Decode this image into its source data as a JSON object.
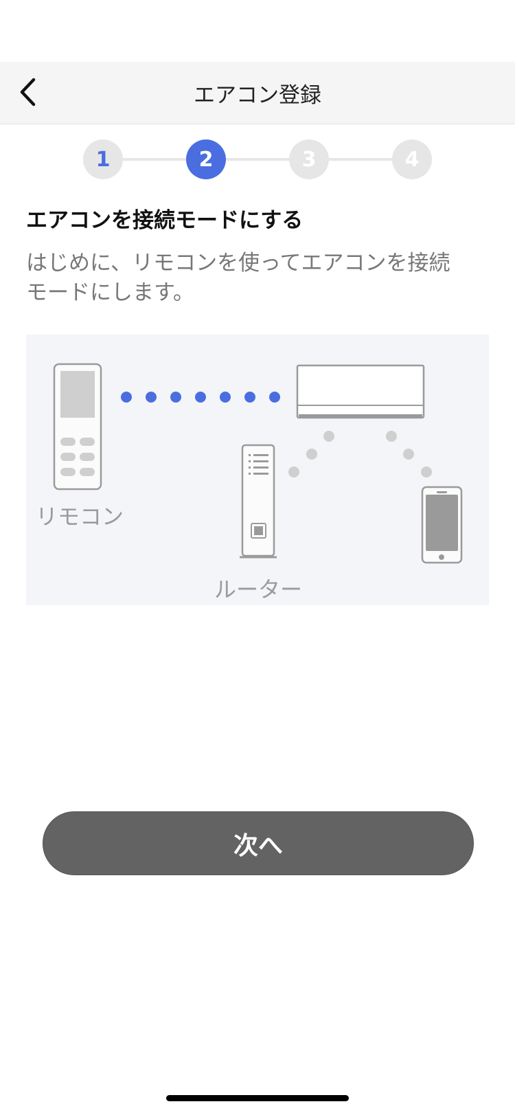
{
  "header": {
    "title": "エアコン登録",
    "back_icon": "chevron-left-icon"
  },
  "stepper": {
    "steps": [
      {
        "label": "1",
        "state": "done"
      },
      {
        "label": "2",
        "state": "active"
      },
      {
        "label": "3",
        "state": "pending"
      },
      {
        "label": "4",
        "state": "pending"
      }
    ],
    "active_color": "#4a6ee0",
    "inactive_color": "#e6e6e6"
  },
  "content": {
    "title": "エアコンを接続モードにする",
    "description_line1": "はじめに、リモコンを使ってエアコンを接続",
    "description_line2": "モードにします。"
  },
  "illustration": {
    "remote_label": "リモコン",
    "router_label": "ルーター",
    "icons": [
      "remote-control-icon",
      "air-conditioner-icon",
      "router-icon",
      "smartphone-icon"
    ],
    "signal_color": "#4a6ee0",
    "pending_signal_color": "#cfcfcf"
  },
  "footer": {
    "next_label": "次へ"
  },
  "colors": {
    "primary": "#4a6ee0",
    "button": "#636363",
    "header_bg": "#f5f5f5"
  }
}
